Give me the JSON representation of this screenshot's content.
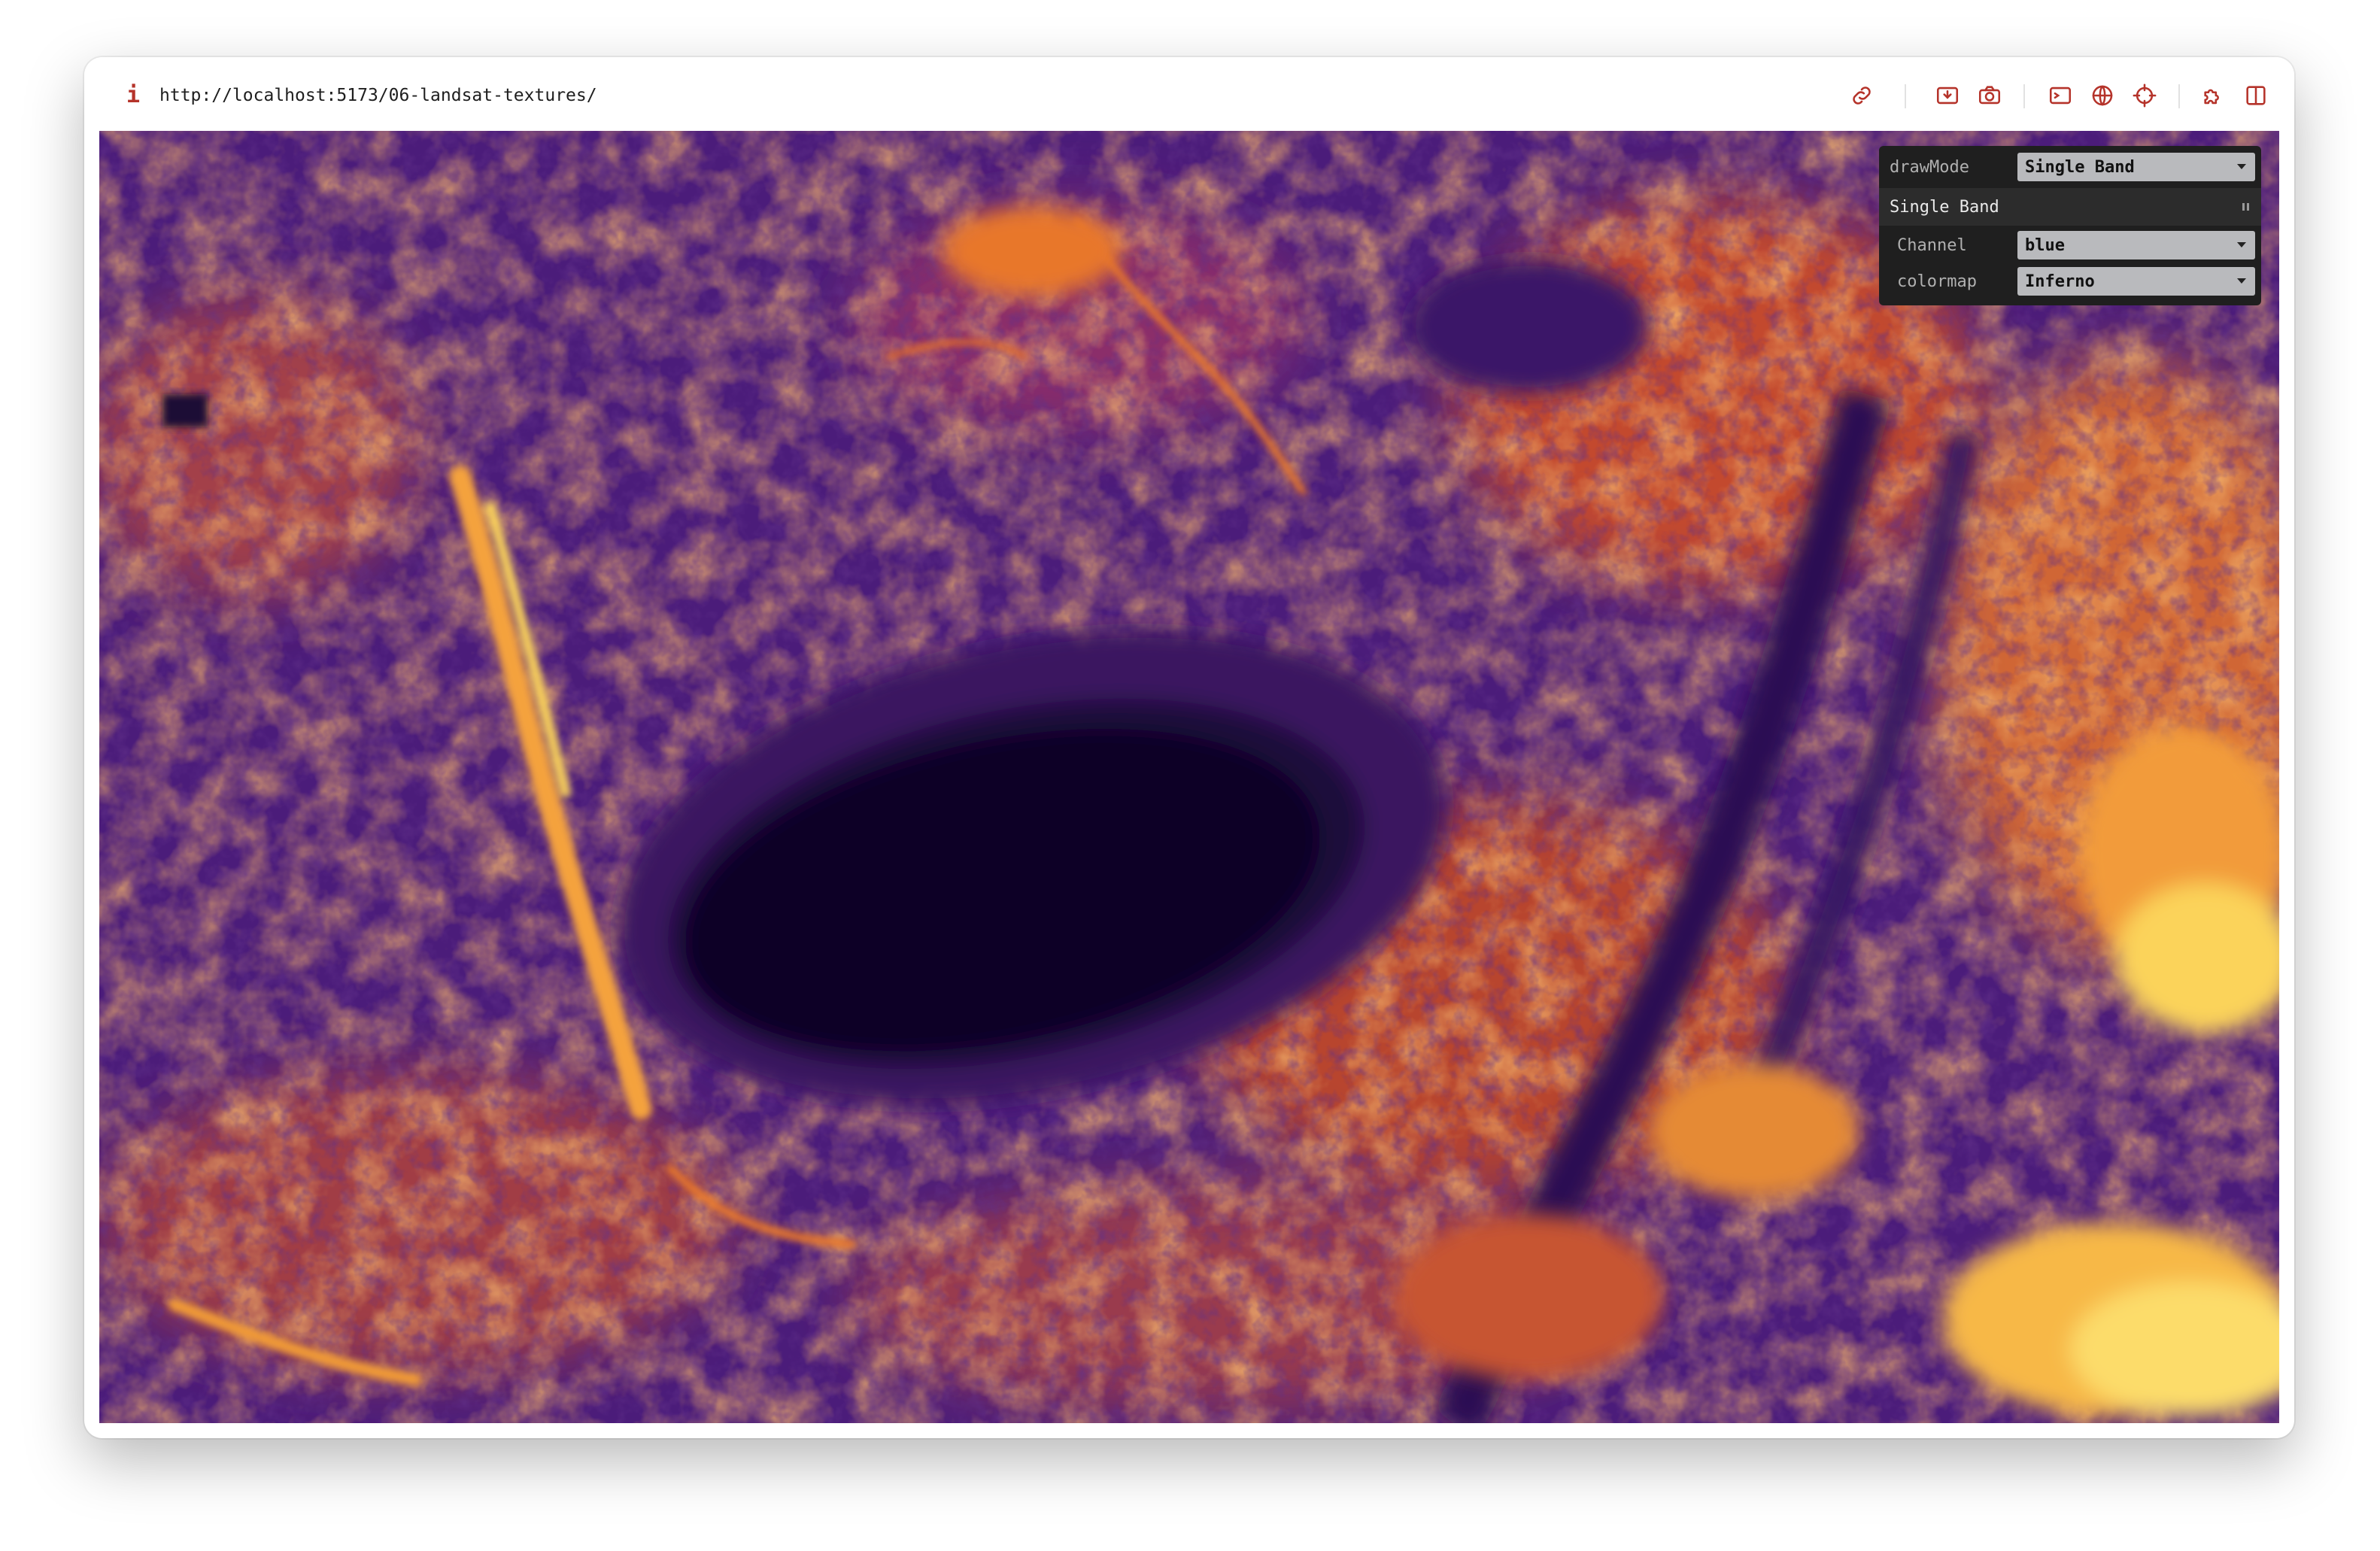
{
  "browser": {
    "info_icon": "i",
    "url": "http://localhost:5173/06-landsat-textures/",
    "toolbar_icons": [
      "link-icon",
      "download-icon",
      "camera-icon",
      "terminal-icon",
      "globe-icon",
      "crosshair-icon",
      "extension-icon",
      "split-view-icon"
    ]
  },
  "gui": {
    "drawmode_label": "drawMode",
    "drawmode_value": "Single Band",
    "folder_title": "Single Band",
    "channel_label": "Channel",
    "channel_value": "blue",
    "colormap_label": "colormap",
    "colormap_value": "Inferno"
  },
  "colors": {
    "colormap_dark": "#0f0428",
    "colormap_purple": "#4a1a78",
    "colormap_mid": "#8a2f6e",
    "colormap_orange": "#e8772a",
    "colormap_yellow": "#fbd35a"
  }
}
